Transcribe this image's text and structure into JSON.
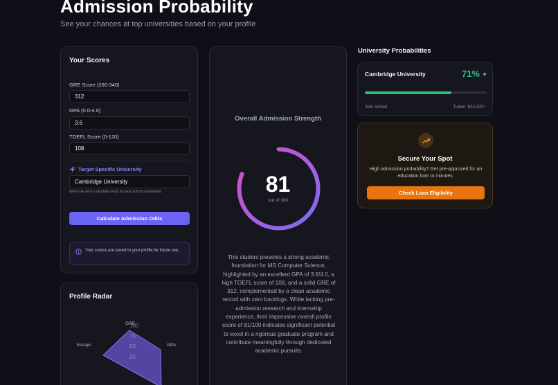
{
  "header": {
    "title": "Admission Probability",
    "subtitle": "See your chances at top universities based on your profile"
  },
  "scores": {
    "title": "Your Scores",
    "gre_label": "GRE Score (260-340)",
    "gre_value": "312",
    "gpa_label": "GPA (0.0-4.0)",
    "gpa_value": "3.6",
    "toefl_label": "TOEFL Score (0-120)",
    "toefl_value": "108",
    "target_label": "Target Specific University",
    "target_value": "Cambridge University",
    "target_hint": "We'll use AI to calculate odds for any school worldwide.",
    "calculate_button": "Calculate Admission Odds",
    "info_text": "Your scores are saved to your profile for future use.",
    "sparkle_icon": "sparkle-icon",
    "info_icon": "info-circle-icon"
  },
  "radar": {
    "title": "Profile Radar",
    "axes": [
      "GRE",
      "GPA",
      "Essays"
    ],
    "ticks": [
      "100",
      "75",
      "50",
      "25"
    ]
  },
  "strength": {
    "title": "Overall Admission Strength",
    "score": "81",
    "score_max_text": "out of 100",
    "score_fraction": 0.81,
    "summary": "This student presents a strong academic foundation for MS Computer Science, highlighted by an excellent GPA of 3.6/4.0, a high TOEFL score of 108, and a solid GRE of 312, complemented by a clean academic record with zero backlogs. While lacking pre-admission research and internship experience, their impressive overall profile score of 81/100 indicates significant potential to excel in a rigorous graduate program and contribute meaningfully through dedicated academic pursuits.",
    "gradient_start": "#7b6cf6",
    "gradient_end": "#d94fc4"
  },
  "probabilities": {
    "heading": "University Probabilities",
    "items": [
      {
        "name": "Cambridge University",
        "percent": "71%",
        "fraction": 0.71,
        "category": "Safe School",
        "tuition": "Tuition: $45,000+",
        "color": "#2fbd7e"
      }
    ]
  },
  "loan": {
    "title": "Secure Your Spot",
    "text": "High admission probability? Get pre-approved for an education loan in minutes.",
    "button": "Check Loan Eligibility",
    "icon": "trending-up-icon",
    "accent": "#e8750f"
  }
}
